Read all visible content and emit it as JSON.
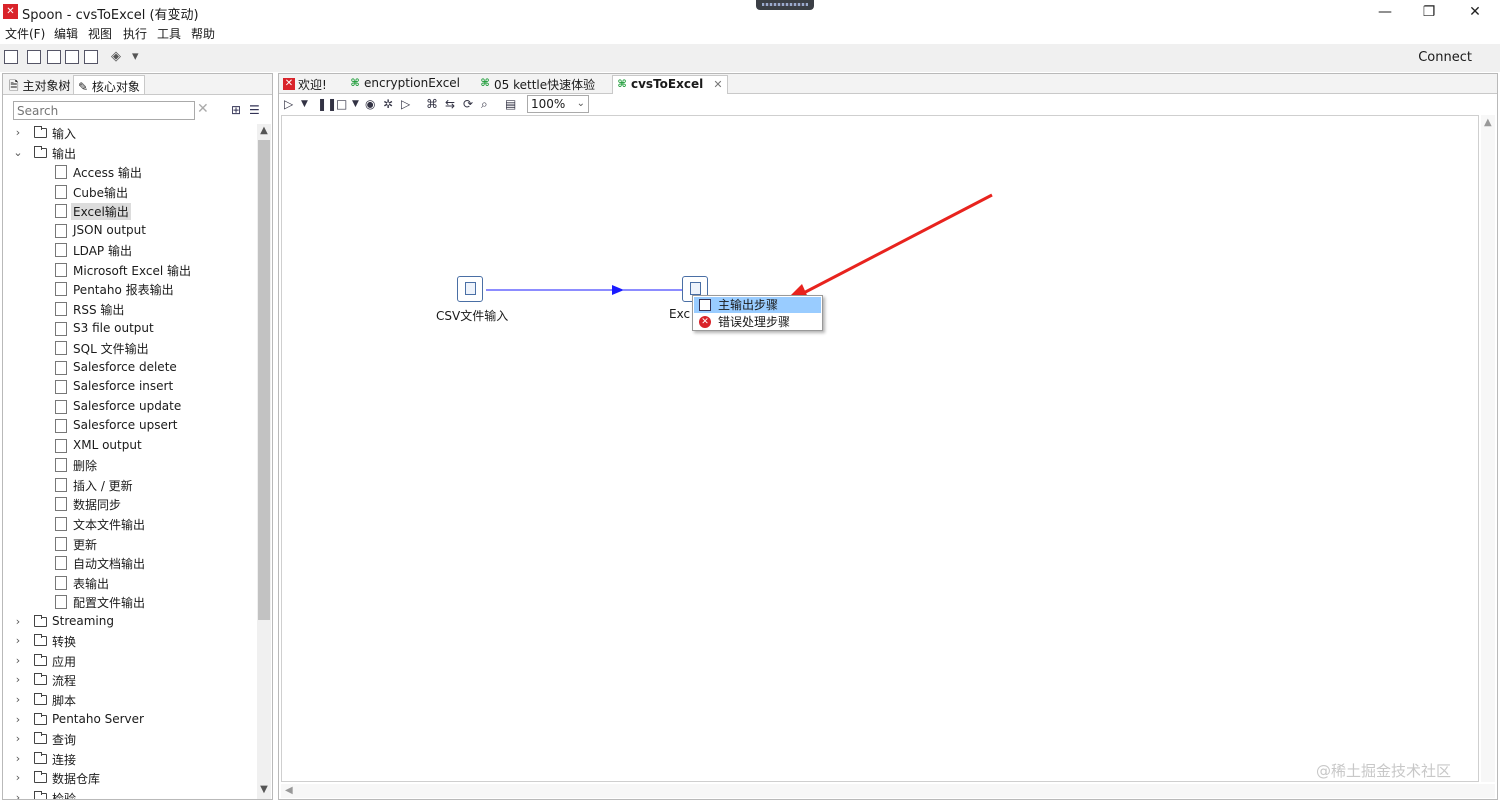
{
  "window": {
    "title": "Spoon - cvsToExcel (有变动)",
    "icon": "spoon-logo-icon"
  },
  "menu": [
    "文件(F)",
    "编辑",
    "视图",
    "执行",
    "工具",
    "帮助"
  ],
  "toolbar": {
    "connect_label": "Connect"
  },
  "left_panel": {
    "tabs": [
      "主对象树",
      "核心对象"
    ],
    "search_placeholder": "Search",
    "tree": [
      {
        "label": "输入",
        "type": "folder",
        "expanded": false
      },
      {
        "label": "输出",
        "type": "folder",
        "expanded": true
      },
      {
        "label": "Access 输出",
        "type": "step"
      },
      {
        "label": "Cube输出",
        "type": "step"
      },
      {
        "label": "Excel输出",
        "type": "step",
        "selected": true
      },
      {
        "label": "JSON output",
        "type": "step"
      },
      {
        "label": "LDAP 输出",
        "type": "step"
      },
      {
        "label": "Microsoft Excel 输出",
        "type": "step"
      },
      {
        "label": "Pentaho 报表输出",
        "type": "step"
      },
      {
        "label": "RSS 输出",
        "type": "step"
      },
      {
        "label": "S3 file output",
        "type": "step"
      },
      {
        "label": "SQL 文件输出",
        "type": "step"
      },
      {
        "label": "Salesforce delete",
        "type": "step"
      },
      {
        "label": "Salesforce insert",
        "type": "step"
      },
      {
        "label": "Salesforce update",
        "type": "step"
      },
      {
        "label": "Salesforce upsert",
        "type": "step"
      },
      {
        "label": "XML output",
        "type": "step"
      },
      {
        "label": "删除",
        "type": "step"
      },
      {
        "label": "插入 / 更新",
        "type": "step"
      },
      {
        "label": "数据同步",
        "type": "step"
      },
      {
        "label": "文本文件输出",
        "type": "step"
      },
      {
        "label": "更新",
        "type": "step"
      },
      {
        "label": "自动文档输出",
        "type": "step"
      },
      {
        "label": "表输出",
        "type": "step"
      },
      {
        "label": "配置文件输出",
        "type": "step"
      },
      {
        "label": "Streaming",
        "type": "folder",
        "expanded": false
      },
      {
        "label": "转换",
        "type": "folder",
        "expanded": false
      },
      {
        "label": "应用",
        "type": "folder",
        "expanded": false
      },
      {
        "label": "流程",
        "type": "folder",
        "expanded": false
      },
      {
        "label": "脚本",
        "type": "folder",
        "expanded": false
      },
      {
        "label": "Pentaho Server",
        "type": "folder",
        "expanded": false
      },
      {
        "label": "查询",
        "type": "folder",
        "expanded": false
      },
      {
        "label": "连接",
        "type": "folder",
        "expanded": false
      },
      {
        "label": "数据仓库",
        "type": "folder",
        "expanded": false
      },
      {
        "label": "检验",
        "type": "folder",
        "expanded": false
      }
    ]
  },
  "editor": {
    "tabs": [
      {
        "label": "欢迎!",
        "icon": "spoon-red",
        "active": false
      },
      {
        "label": "encryptionExcel",
        "icon": "transform-green",
        "active": false
      },
      {
        "label": "05 kettle快速体验",
        "icon": "transform-green",
        "active": false
      },
      {
        "label": "cvsToExcel",
        "icon": "transform-green",
        "active": true
      }
    ],
    "zoom": "100%",
    "steps": [
      {
        "id": "csv",
        "label": "CSV文件输入"
      },
      {
        "id": "excel",
        "label": "Exc"
      }
    ],
    "context_menu": [
      {
        "label": "主输出步骤",
        "icon": "main-output-icon",
        "highlighted": true
      },
      {
        "label": "错误处理步骤",
        "icon": "error-handling-icon",
        "highlighted": false
      }
    ]
  },
  "watermark": "@稀土掘金技术社区",
  "colors": {
    "hop_line": "#1a1aff",
    "annotation_arrow": "#e8231e",
    "menu_highlight": "#99ccff"
  }
}
